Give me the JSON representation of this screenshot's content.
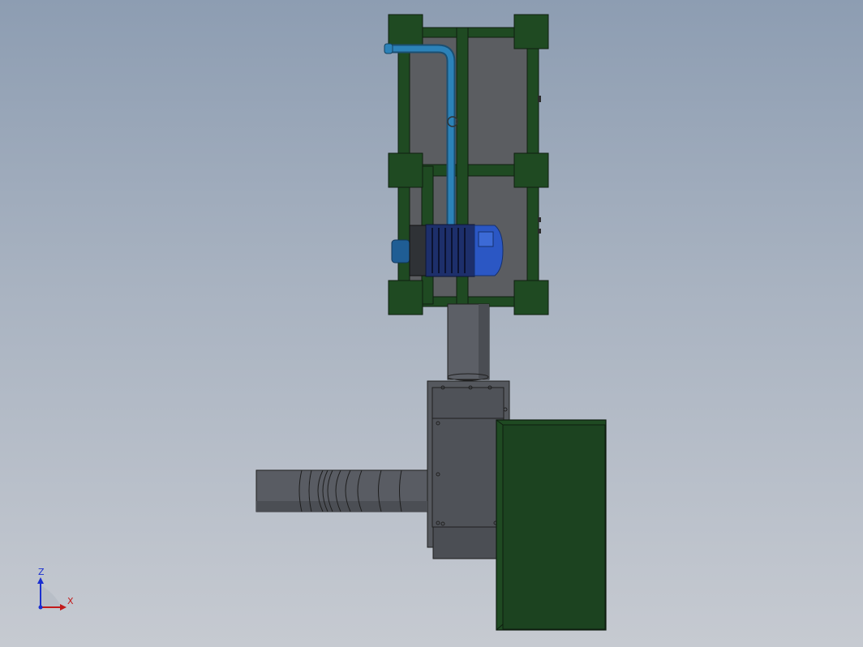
{
  "colors": {
    "background_top": "#8d9db2",
    "background_bottom": "#c6cad1",
    "frame_green": "#1f4a22",
    "panel_grey": "#5a5d62",
    "duct_grey": "#595c63",
    "motor_blue": "#2b57c4",
    "pipe_blue": "#2c82b8",
    "outline": "#1b1b1b",
    "axis_blue": "#1a2fd0",
    "axis_red": "#c21a1a"
  },
  "triad": {
    "vertical_label": "Z",
    "horizontal_label": "X"
  },
  "components": [
    "equipment-frame",
    "circulation-pipe",
    "pump-motor",
    "vertical-duct",
    "fan-housing",
    "inlet-duct",
    "control-cabinet"
  ]
}
